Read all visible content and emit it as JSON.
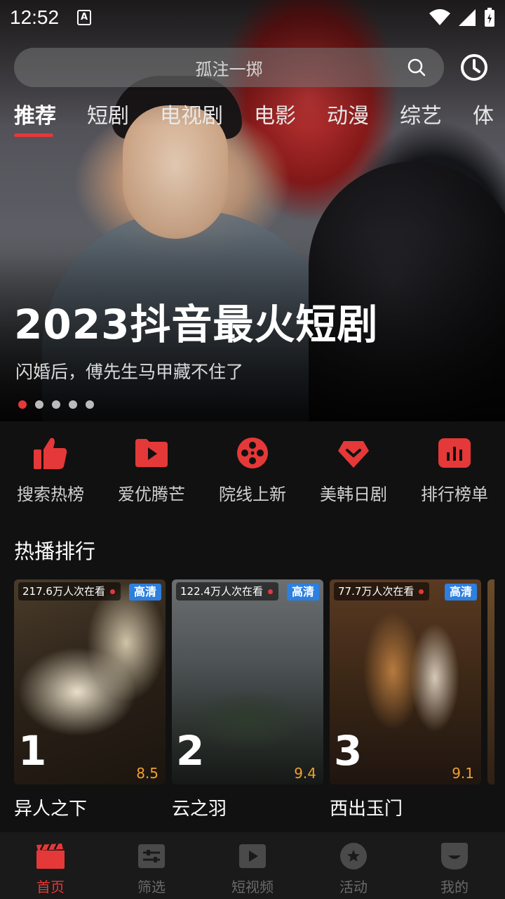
{
  "status_bar": {
    "time": "12:52"
  },
  "search": {
    "placeholder": "孤注一掷"
  },
  "tabs": [
    {
      "label": "推荐"
    },
    {
      "label": "短剧"
    },
    {
      "label": "电视剧"
    },
    {
      "label": "电影"
    },
    {
      "label": "动漫"
    },
    {
      "label": "综艺"
    },
    {
      "label": "体"
    }
  ],
  "hero": {
    "title": "2023抖音最火短剧",
    "subtitle": "闪婚后，傅先生马甲藏不住了",
    "dot_count": 5,
    "active_dot": 1
  },
  "quick_entries": [
    {
      "label": "搜索热榜",
      "icon": "thumbs-up-icon"
    },
    {
      "label": "爱优腾芒",
      "icon": "play-icon"
    },
    {
      "label": "院线上新",
      "icon": "film-reel-icon"
    },
    {
      "label": "美韩日剧",
      "icon": "heart-icon"
    },
    {
      "label": "排行榜单",
      "icon": "bar-chart-icon"
    }
  ],
  "section": {
    "title": "热播排行"
  },
  "cards": [
    {
      "title": "异人之下",
      "viewers": "217.6万人次在看",
      "badge": "高清",
      "rank": "1",
      "score": "8.5"
    },
    {
      "title": "云之羽",
      "viewers": "122.4万人次在看",
      "badge": "高清",
      "rank": "2",
      "score": "9.4"
    },
    {
      "title": "西出玉门",
      "viewers": "77.7万人次在看",
      "badge": "高清",
      "rank": "3",
      "score": "9.1"
    }
  ],
  "bottom_nav": [
    {
      "label": "首页",
      "icon": "clapperboard-icon",
      "active": true
    },
    {
      "label": "筛选",
      "icon": "sliders-icon",
      "active": false
    },
    {
      "label": "短视频",
      "icon": "video-icon",
      "active": false
    },
    {
      "label": "活动",
      "icon": "star-icon",
      "active": false
    },
    {
      "label": "我的",
      "icon": "profile-icon",
      "active": false
    }
  ],
  "colors": {
    "accent": "#e53838",
    "background": "#111111",
    "badge": "#2d7fe0",
    "score": "#f0a030"
  }
}
